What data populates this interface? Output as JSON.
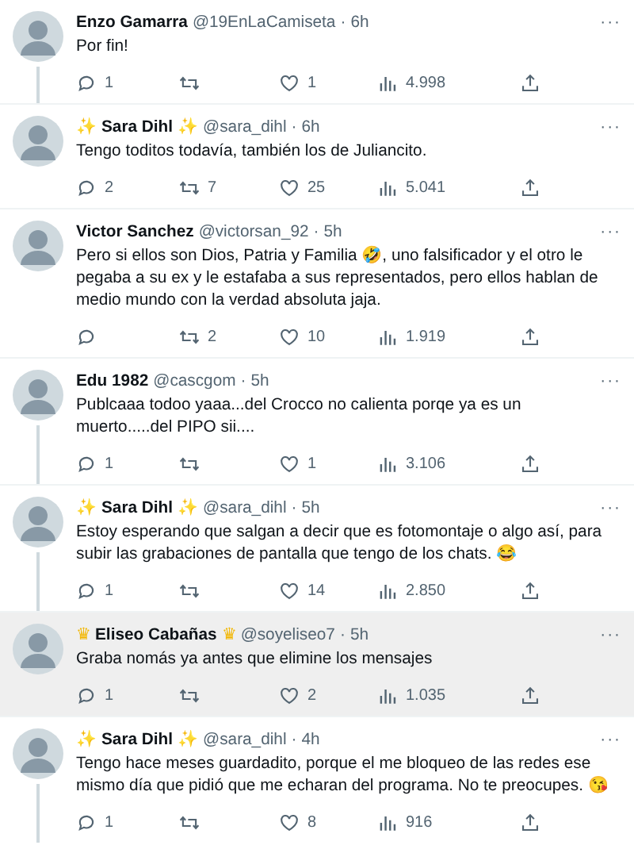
{
  "tweets": [
    {
      "name": "Enzo Gamarra",
      "handle": "@19EnLaCamiseta",
      "separator": "·",
      "time": "6h",
      "more": "···",
      "text": "Por fin!",
      "replies": "1",
      "likes": "1",
      "views": "4.998",
      "thread_below": true,
      "highlighted": false
    },
    {
      "name": "Sara Dihl",
      "name_emoji": "✨",
      "handle": "@sara_dihl",
      "separator": "·",
      "time": "6h",
      "more": "···",
      "text": "Tengo toditos todavía, también los de Juliancito.",
      "replies": "2",
      "retweets": "7",
      "likes": "25",
      "views": "5.041",
      "thread_below": false,
      "highlighted": false
    },
    {
      "name": "Victor Sanchez",
      "handle": "@victorsan_92",
      "separator": "·",
      "time": "5h",
      "more": "···",
      "text": "Pero si ellos son Dios, Patria y Familia 🤣, uno falsificador y el otro le pegaba a su ex y le estafaba a sus representados, pero ellos hablan de medio mundo con la verdad absoluta jaja.",
      "retweets": "2",
      "likes": "10",
      "views": "1.919",
      "thread_below": false,
      "highlighted": false
    },
    {
      "name": "Edu 1982",
      "handle": "@cascgom",
      "separator": "·",
      "time": "5h",
      "more": "···",
      "text": "Publcaaa todoo yaaa...del Crocco no calienta porqe ya es un muerto.....del PIPO sii....",
      "replies": "1",
      "likes": "1",
      "views": "3.106",
      "thread_below": true,
      "highlighted": false
    },
    {
      "name": "Sara Dihl",
      "name_emoji": "✨",
      "handle": "@sara_dihl",
      "separator": "·",
      "time": "5h",
      "more": "···",
      "text": "Estoy esperando que salgan a decir que es fotomontaje o algo así, para subir las grabaciones de pantalla que tengo de los chats. 😂",
      "replies": "1",
      "likes": "14",
      "views": "2.850",
      "thread_below": true,
      "highlighted": false
    },
    {
      "name": "Eliseo Cabañas",
      "name_emoji": "♛",
      "handle": "@soyeliseo7",
      "separator": "·",
      "time": "5h",
      "more": "···",
      "text": "Graba nomás ya antes que elimine los mensajes",
      "replies": "1",
      "likes": "2",
      "views": "1.035",
      "thread_below": false,
      "highlighted": true
    },
    {
      "name": "Sara Dihl",
      "name_emoji": "✨",
      "handle": "@sara_dihl",
      "separator": "·",
      "time": "4h",
      "more": "···",
      "text": "Tengo hace meses guardadito, porque el me bloqueo de las redes ese mismo día que pidió que me echaran del programa. No te preocupes. 😘",
      "replies": "1",
      "likes": "8",
      "views": "916",
      "thread_below": true,
      "highlighted": false
    }
  ]
}
